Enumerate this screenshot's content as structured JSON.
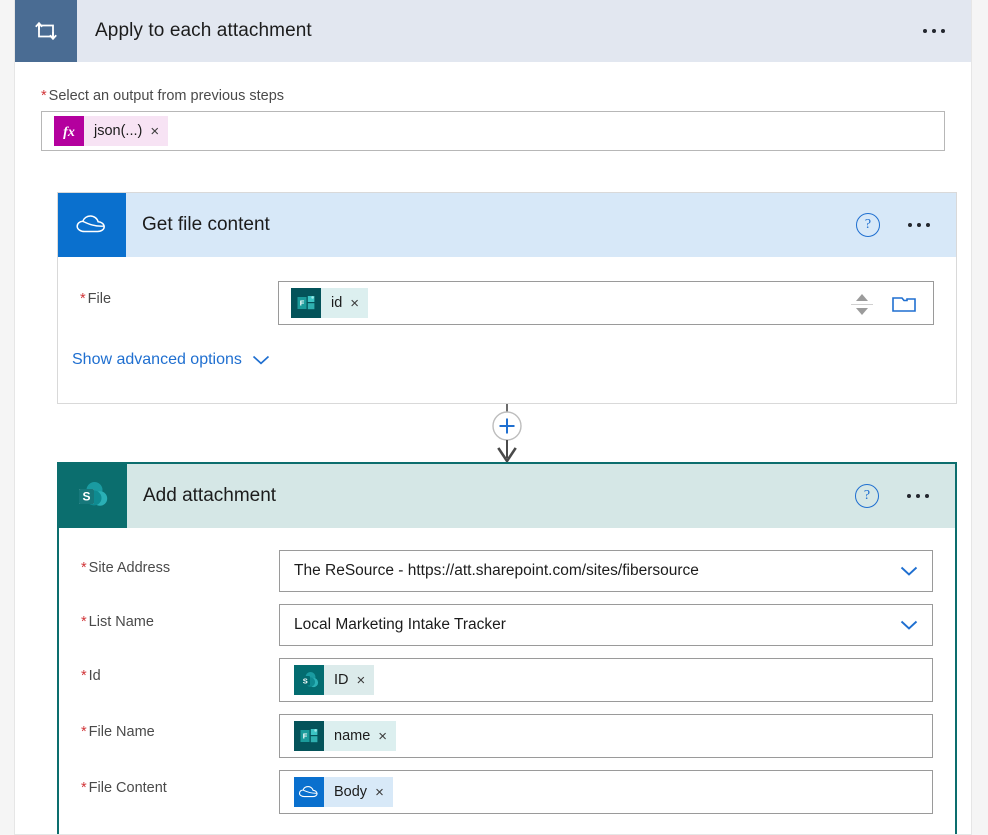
{
  "loop": {
    "title": "Apply to each attachment",
    "icon": "loop-icon",
    "menu": "more-commands",
    "foreach_label": "Select an output from previous steps",
    "required_mark": "*",
    "token": {
      "text": "json(...)",
      "icon": "fx-icon",
      "remove": "×"
    }
  },
  "onedrive_action": {
    "title": "Get file content",
    "icon": "onedrive-icon",
    "help": "?",
    "menu": "more-commands",
    "fields": [
      {
        "label": "File",
        "required": "*",
        "token": {
          "text": "id",
          "icon": "forms-icon",
          "remove": "×"
        },
        "picker_icon": "folder-icon",
        "spinner": "up-down-spinner"
      }
    ],
    "advanced_link": "Show advanced options",
    "advanced_chevron": "chevron-down-icon"
  },
  "insert_step": {
    "icon": "plus-icon",
    "arrow": "arrow-down-icon"
  },
  "sharepoint_action": {
    "title": "Add attachment",
    "icon": "sharepoint-icon",
    "help": "?",
    "menu": "more-commands",
    "fields": [
      {
        "label": "Site Address",
        "required": "*",
        "type": "dropdown",
        "value": "The ReSource - https://att.sharepoint.com/sites/fibersource",
        "chevron": "chevron-down-icon"
      },
      {
        "label": "List Name",
        "required": "*",
        "type": "dropdown",
        "value": "Local Marketing Intake Tracker",
        "chevron": "chevron-down-icon"
      },
      {
        "label": "Id",
        "required": "*",
        "type": "token",
        "token": {
          "text": "ID",
          "icon": "sharepoint-icon",
          "remove": "×"
        }
      },
      {
        "label": "File Name",
        "required": "*",
        "type": "token",
        "token": {
          "text": "name",
          "icon": "forms-icon",
          "remove": "×"
        }
      },
      {
        "label": "File Content",
        "required": "*",
        "type": "token",
        "token": {
          "text": "Body",
          "icon": "onedrive-icon",
          "remove": "×"
        }
      }
    ]
  },
  "colors": {
    "loop_header_bg": "#e2e7f0",
    "loop_icon_bg": "#4a6c93",
    "onedrive_blue": "#0a70ce",
    "onedrive_header_bg": "#d7e8f8",
    "sharepoint_teal": "#0b6e6e",
    "sharepoint_header_bg": "#d5e7e6",
    "selection_border": "#0c6e6e",
    "required_red": "#d13438",
    "link_blue": "#1f6fd0",
    "fx_magenta": "#b4009e",
    "forms_teal": "#04535a"
  }
}
